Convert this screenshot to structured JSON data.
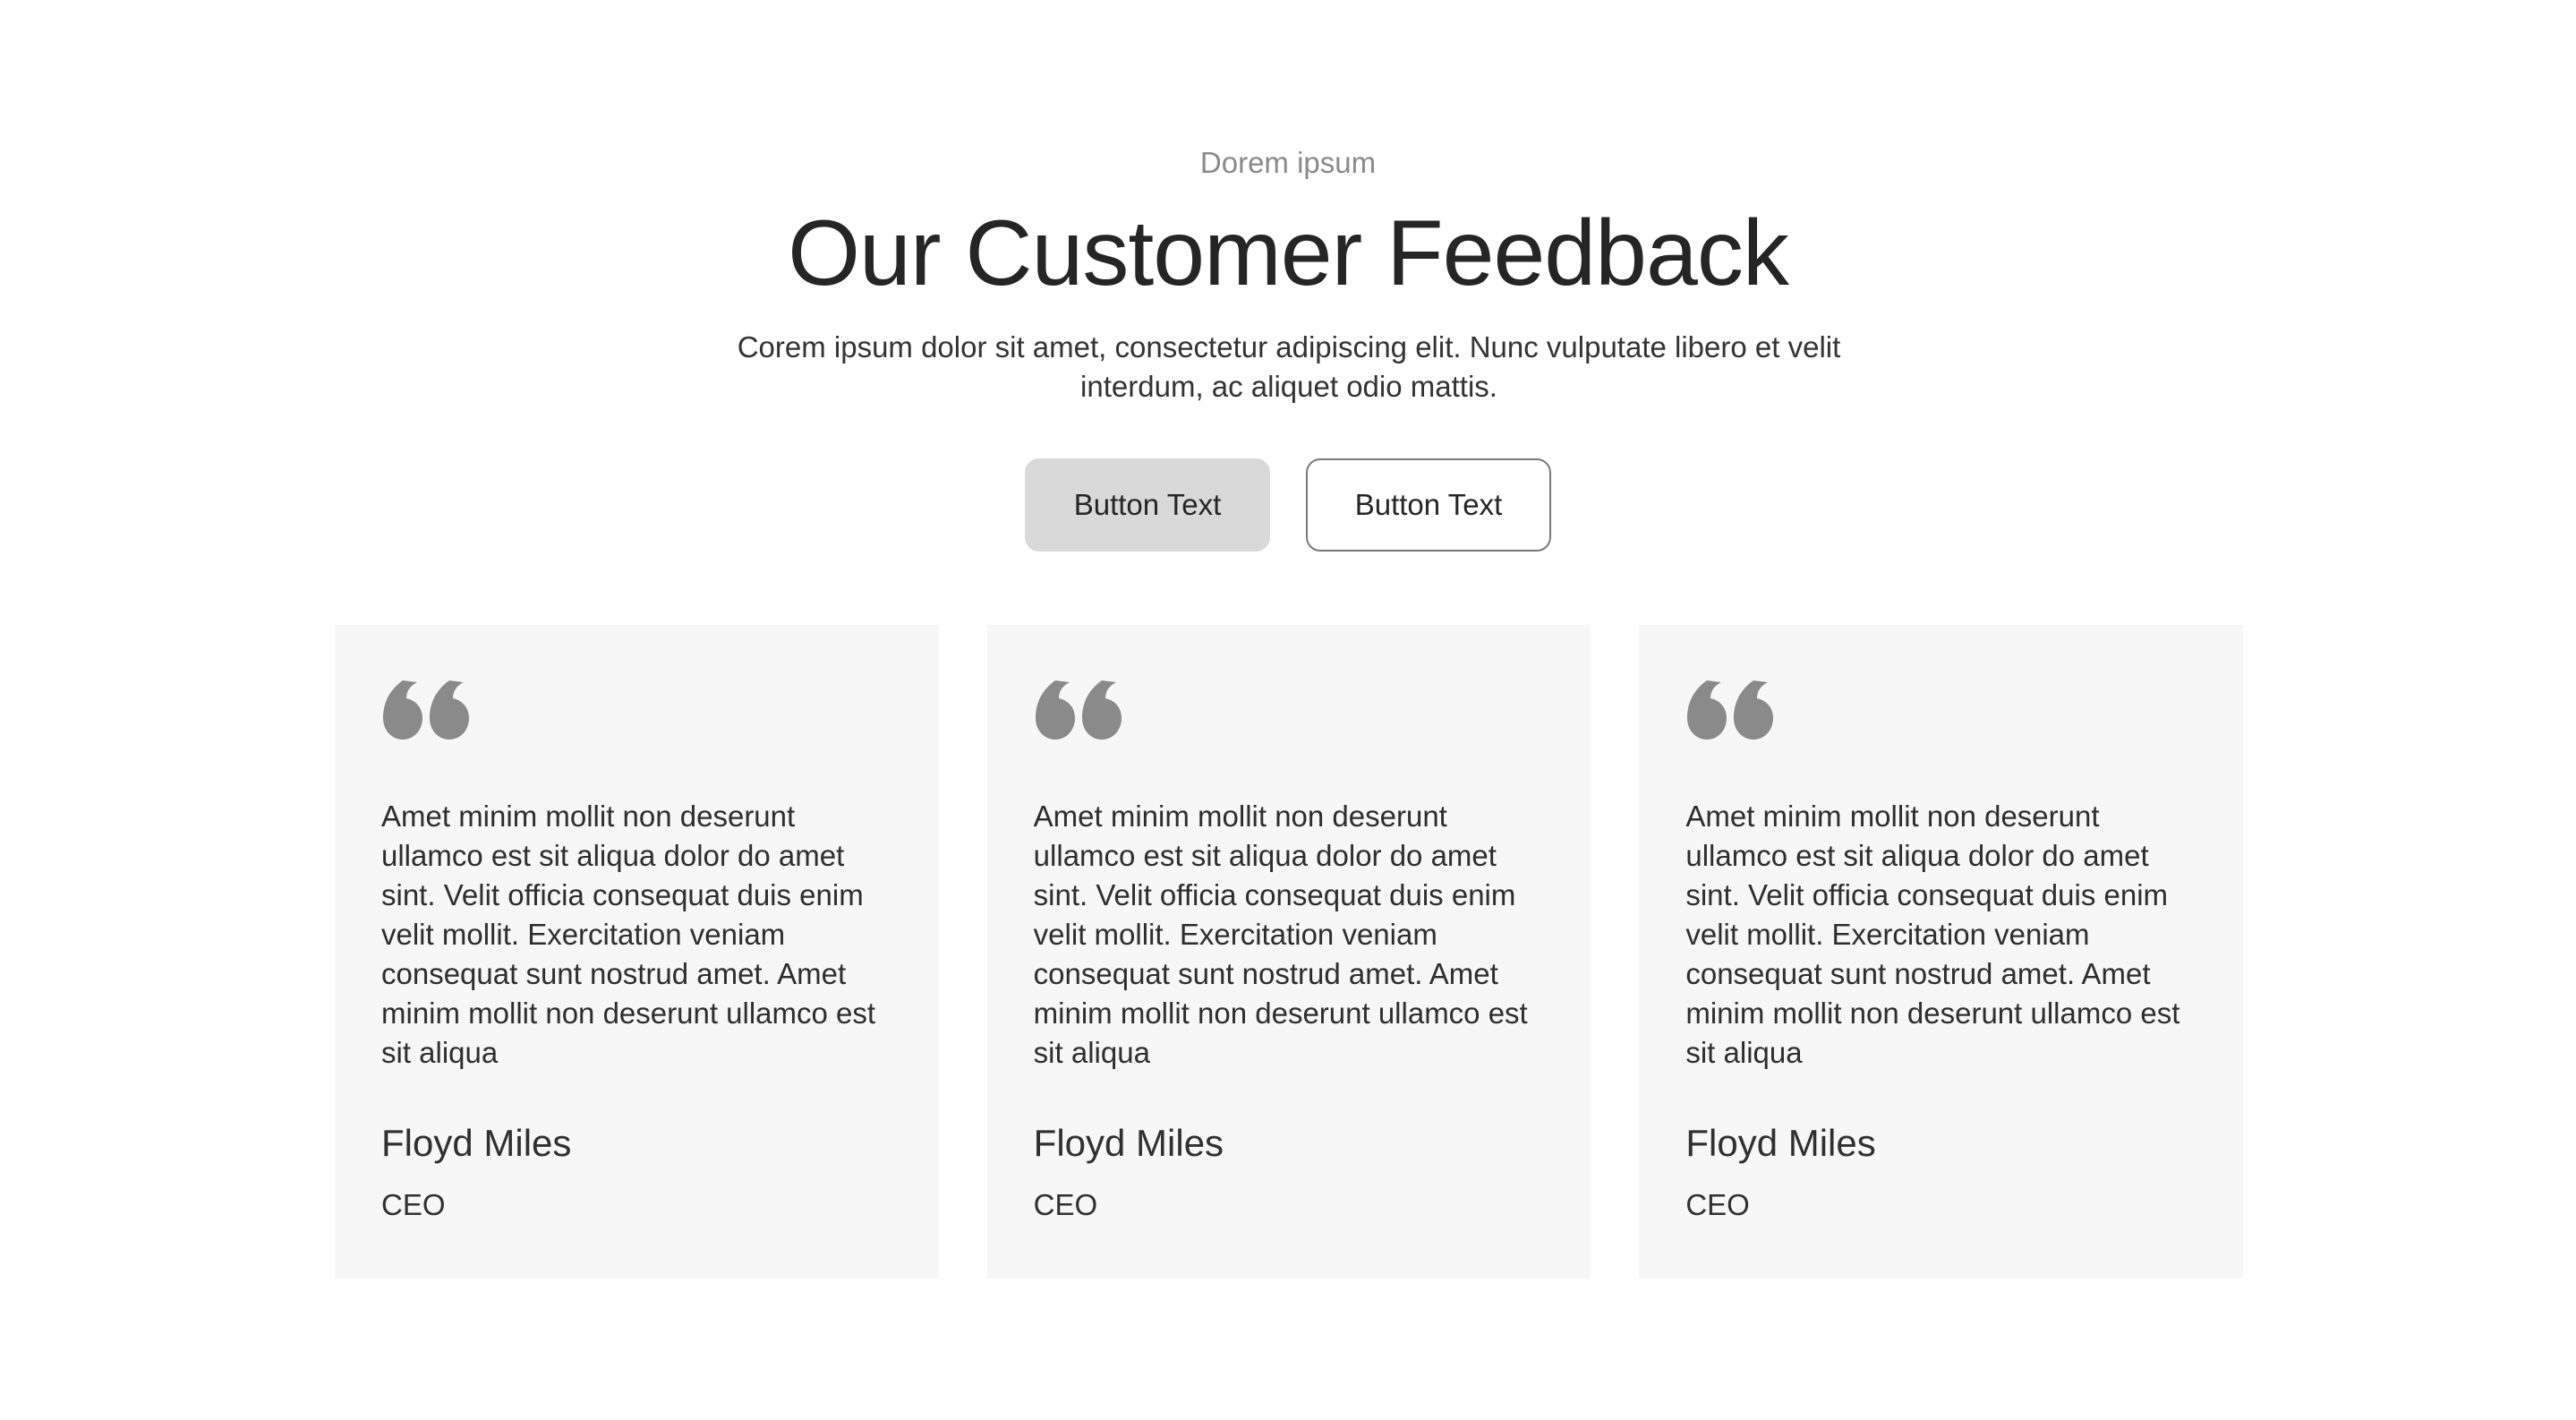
{
  "header": {
    "eyebrow": "Dorem ipsum",
    "title": "Our Customer Feedback",
    "subtitle": "Corem ipsum dolor sit amet, consectetur adipiscing elit. Nunc vulputate libero et velit interdum, ac aliquet odio mattis."
  },
  "buttons": {
    "primary_label": "Button Text",
    "secondary_label": "Button Text"
  },
  "testimonials": [
    {
      "icon": "quote-icon",
      "text": "Amet minim mollit non deserunt ullamco est sit aliqua dolor do amet sint. Velit officia consequat duis enim velit mollit. Exercitation veniam consequat sunt nostrud amet. Amet minim mollit non deserunt ullamco est sit aliqua",
      "name": "Floyd Miles",
      "role": "CEO"
    },
    {
      "icon": "quote-icon",
      "text": "Amet minim mollit non deserunt ullamco est sit aliqua dolor do amet sint. Velit officia consequat duis enim velit mollit. Exercitation veniam consequat sunt nostrud amet. Amet minim mollit non deserunt ullamco est sit aliqua",
      "name": "Floyd Miles",
      "role": "CEO"
    },
    {
      "icon": "quote-icon",
      "text": "Amet minim mollit non deserunt ullamco est sit aliqua dolor do amet sint. Velit officia consequat duis enim velit mollit. Exercitation veniam consequat sunt nostrud amet. Amet minim mollit non deserunt ullamco est sit aliqua",
      "name": "Floyd Miles",
      "role": "CEO"
    }
  ],
  "colors": {
    "card_background": "#f7f7f7",
    "quote_icon": "#8a8a8a",
    "primary_button": "#d9d9d9",
    "secondary_button_border": "#7a7a7a"
  }
}
